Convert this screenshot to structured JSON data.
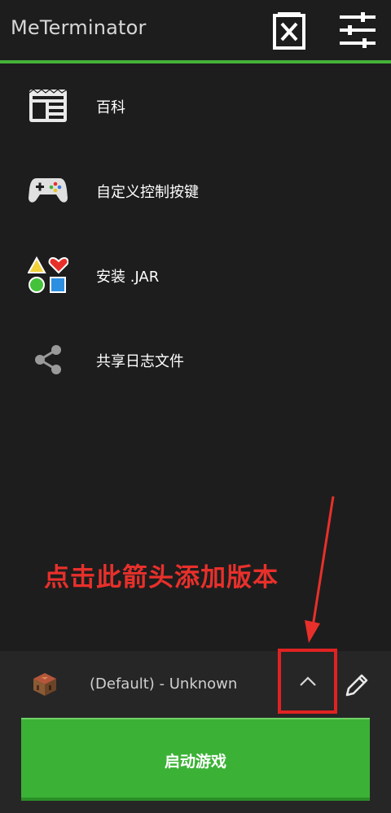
{
  "app": {
    "title": "MeTerminator"
  },
  "toolbar": {
    "delete_icon": "delete-profile-icon",
    "settings_icon": "settings-sliders-icon"
  },
  "menu": {
    "items": [
      {
        "label": "百科",
        "icon": "wiki-icon"
      },
      {
        "label": "自定义控制按键",
        "icon": "gamepad-icon"
      },
      {
        "label": "安装 .JAR",
        "icon": "shapes-icon"
      },
      {
        "label": "共享日志文件",
        "icon": "share-icon"
      }
    ]
  },
  "annotation": {
    "text": "点击此箭头添加版本",
    "color": "#e8302b"
  },
  "version": {
    "label": "(Default) - Unknown",
    "icon": "crafting-table-icon"
  },
  "launch": {
    "label": "启动游戏"
  },
  "colors": {
    "accent": "#45b23a",
    "button": "#3bb236",
    "background": "#1d1d1d",
    "highlight": "#e02222"
  }
}
